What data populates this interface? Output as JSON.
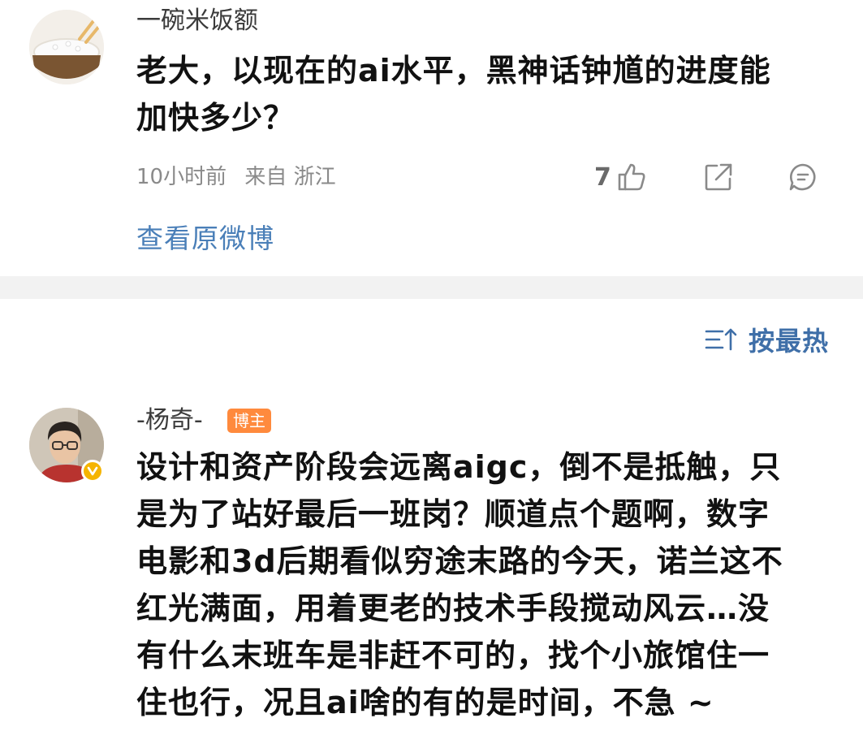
{
  "top_comment": {
    "username": "一碗米饭额",
    "text_lines": [
      "老大，以现在的ai水平，黑神话钟馗的进度能",
      "加快多少？"
    ],
    "time": "10小时前",
    "location": "来自 浙江",
    "like_count": "7",
    "view_original": "查看原微博"
  },
  "sort": {
    "label": "按最热"
  },
  "reply": {
    "username": "-杨奇-",
    "badge": "博主",
    "text_lines": [
      "设计和资产阶段会远离aigc，倒不是抵触，只",
      "是为了站好最后一班岗？顺道点个题啊，数字",
      "电影和3d后期看似穷途末路的今天，诺兰这不",
      "红光满面，用着更老的技术手段搅动风云…没",
      "有什么末班车是非赶不可的，找个小旅馆住一",
      "住也行，况且ai啥的有的是时间，不急 ~"
    ]
  },
  "icons": {
    "like": "thumbs-up-icon",
    "share": "share-icon",
    "comment": "comment-icon",
    "sort": "sort-icon",
    "verified": "verified-icon"
  },
  "colors": {
    "link_blue": "#4a7fb8",
    "sort_blue": "#3f6fa8",
    "badge_orange": "#ff8a3d",
    "verified_gold": "#f5b400",
    "divider_gray": "#f2f2f2"
  }
}
